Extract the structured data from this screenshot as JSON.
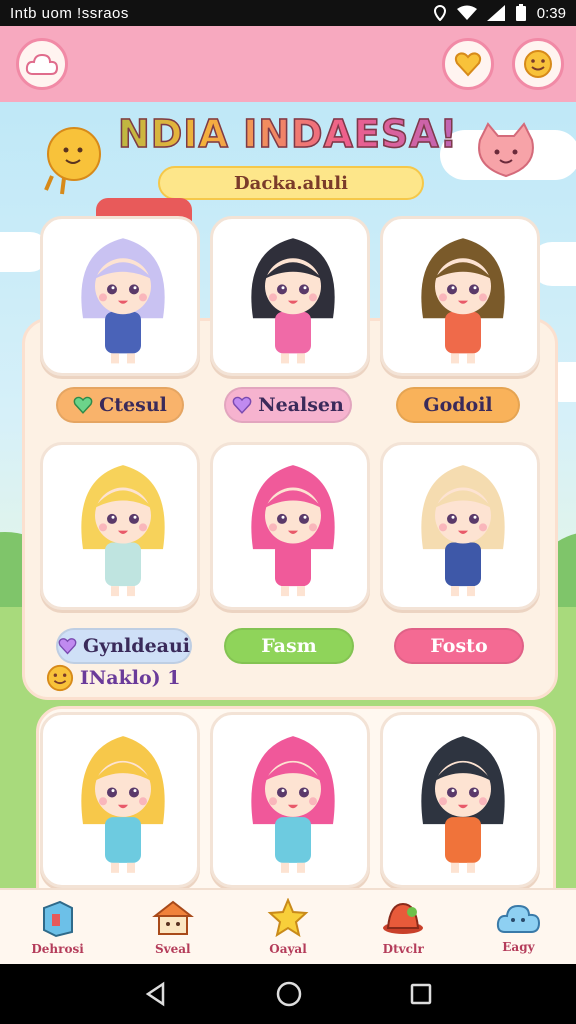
{
  "status_bar": {
    "left_text": "Intb  uom !ssraos",
    "time": "0:39"
  },
  "header": {
    "left_icon": "cloud-icon",
    "right_icons": [
      "heart-icon",
      "smile-icon"
    ]
  },
  "banner": {
    "title": "NDIA INDAESA!",
    "subtitle": "Dacka.aluli"
  },
  "characters": [
    {
      "label": "Ctesul",
      "button_color": "#f9b36b",
      "hair": "#c9c2f2",
      "dress": "#4a63b8",
      "icon": "green-heart-icon"
    },
    {
      "label": "Nealsen",
      "button_color": "#f6b3cf",
      "hair": "#2f2f3a",
      "dress": "#f06aa7",
      "icon": "purple-heart-icon"
    },
    {
      "label": "Godoil",
      "button_color": "#f9b25a",
      "hair": "#7a5a2a",
      "dress": "#ef6a4a",
      "icon": ""
    },
    {
      "label": "Gynldeaui",
      "button_color": "#cfe0f7",
      "hair": "#f7d25a",
      "dress": "#bfe4e0",
      "icon": "purple-heart-icon"
    },
    {
      "label": "Fasm",
      "button_color": "#8fd45a",
      "hair": "#f05a9a",
      "dress": "#f05a9a",
      "icon": ""
    },
    {
      "label": "Fosto",
      "button_color": "#f46a93",
      "hair": "#f5dcb0",
      "dress": "#3e58a8",
      "icon": ""
    },
    {
      "hair": "#f7c84a",
      "dress": "#6dcbe0"
    },
    {
      "hair": "#f0589a",
      "dress": "#6dcbe0"
    },
    {
      "hair": "#2e3440",
      "dress": "#f0733a"
    }
  ],
  "badge": {
    "text": "INaklo) 1"
  },
  "bottom_nav": [
    {
      "label": "Dehrosi",
      "icon": "book-icon"
    },
    {
      "label": "Sveal",
      "icon": "house-icon"
    },
    {
      "label": "Oayal",
      "icon": "star-icon"
    },
    {
      "label": "Dtvclr",
      "icon": "hat-icon"
    },
    {
      "label": "Eagy",
      "icon": "cloud-icon"
    }
  ]
}
